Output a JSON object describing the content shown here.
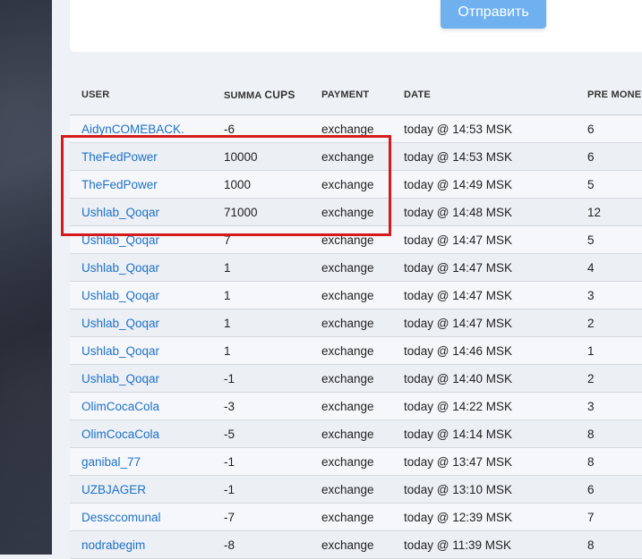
{
  "form": {
    "send_label": "Отправить"
  },
  "table": {
    "headers": {
      "user": "USER",
      "summa": "SUMMA",
      "cups": "CUPS",
      "payment": "PAYMENT",
      "date": "DATE",
      "pre_money": "PRE MONEY"
    },
    "rows": [
      {
        "user": "AidynCOMEBACK.",
        "sum": "-6",
        "payment": "exchange",
        "date": "today @ 14:53 MSK",
        "pre": "6"
      },
      {
        "user": "TheFedPower",
        "sum": "10000",
        "payment": "exchange",
        "date": "today @ 14:53 MSK",
        "pre": "6"
      },
      {
        "user": "TheFedPower",
        "sum": "1000",
        "payment": "exchange",
        "date": "today @ 14:49 MSK",
        "pre": "5"
      },
      {
        "user": "Ushlab_Qoqar",
        "sum": "71000",
        "payment": "exchange",
        "date": "today @ 14:48 MSK",
        "pre": "12"
      },
      {
        "user": "Ushlab_Qoqar",
        "sum": "7",
        "payment": "exchange",
        "date": "today @ 14:47 MSK",
        "pre": "5"
      },
      {
        "user": "Ushlab_Qoqar",
        "sum": "1",
        "payment": "exchange",
        "date": "today @ 14:47 MSK",
        "pre": "4"
      },
      {
        "user": "Ushlab_Qoqar",
        "sum": "1",
        "payment": "exchange",
        "date": "today @ 14:47 MSK",
        "pre": "3"
      },
      {
        "user": "Ushlab_Qoqar",
        "sum": "1",
        "payment": "exchange",
        "date": "today @ 14:47 MSK",
        "pre": "2"
      },
      {
        "user": "Ushlab_Qoqar",
        "sum": "1",
        "payment": "exchange",
        "date": "today @ 14:46 MSK",
        "pre": "1"
      },
      {
        "user": "Ushlab_Qoqar",
        "sum": "-1",
        "payment": "exchange",
        "date": "today @ 14:40 MSK",
        "pre": "2"
      },
      {
        "user": "OlimCocaCola",
        "sum": "-3",
        "payment": "exchange",
        "date": "today @ 14:22 MSK",
        "pre": "3"
      },
      {
        "user": "OlimCocaCola",
        "sum": "-5",
        "payment": "exchange",
        "date": "today @ 14:14 MSK",
        "pre": "8"
      },
      {
        "user": "ganibal_77",
        "sum": "-1",
        "payment": "exchange",
        "date": "today @ 13:47 MSK",
        "pre": "8"
      },
      {
        "user": "UZBJAGER",
        "sum": "-1",
        "payment": "exchange",
        "date": "today @ 13:10 MSK",
        "pre": "6"
      },
      {
        "user": "Dessccomunal",
        "sum": "-7",
        "payment": "exchange",
        "date": "today @ 12:39 MSK",
        "pre": "7"
      },
      {
        "user": "nodrabegim",
        "sum": "-8",
        "payment": "exchange",
        "date": "today @ 11:39 MSK",
        "pre": "8"
      }
    ]
  },
  "colors": {
    "accent": "#6fb0ef",
    "link": "#1d72c9",
    "highlight": "#d41a1a"
  }
}
